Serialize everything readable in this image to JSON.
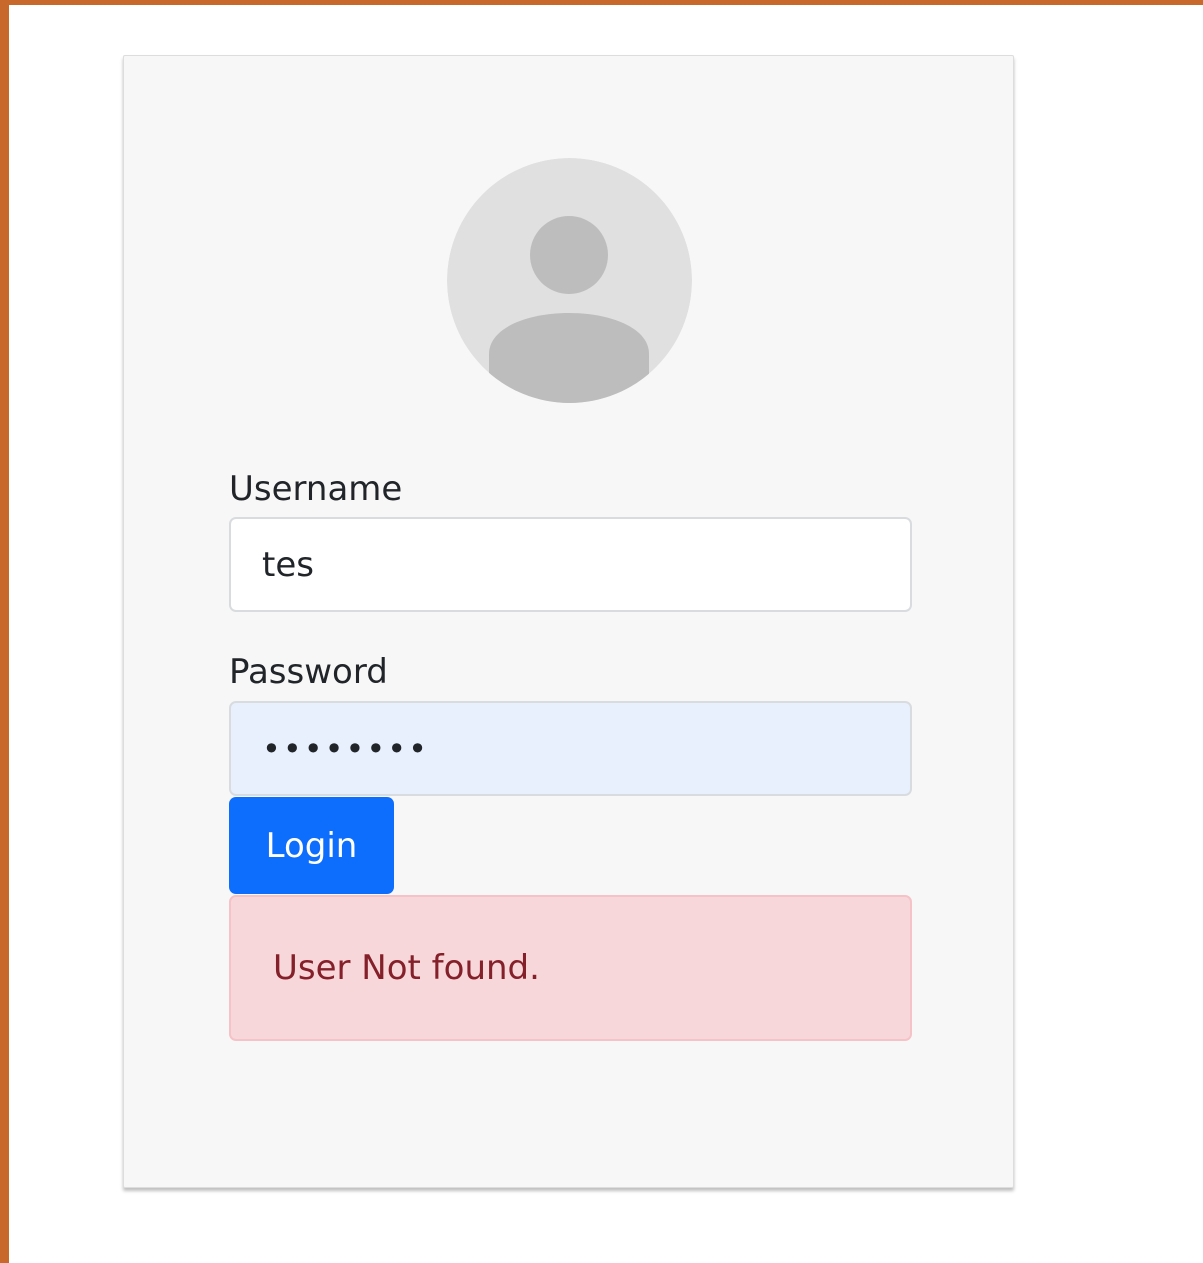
{
  "colors": {
    "frame": "#c8682a",
    "card_background": "#f7f7f7",
    "primary_button": "#0d6efd",
    "autofill_background": "#e8f0fe",
    "alert_background": "#f8d7da",
    "alert_text": "#842029"
  },
  "avatar": {
    "icon": "user-avatar-placeholder-icon"
  },
  "form": {
    "username": {
      "label": "Username",
      "value": "tes"
    },
    "password": {
      "label": "Password",
      "value": "••••••••"
    },
    "login_button": {
      "label": "Login"
    }
  },
  "alert": {
    "message": "User Not found."
  }
}
